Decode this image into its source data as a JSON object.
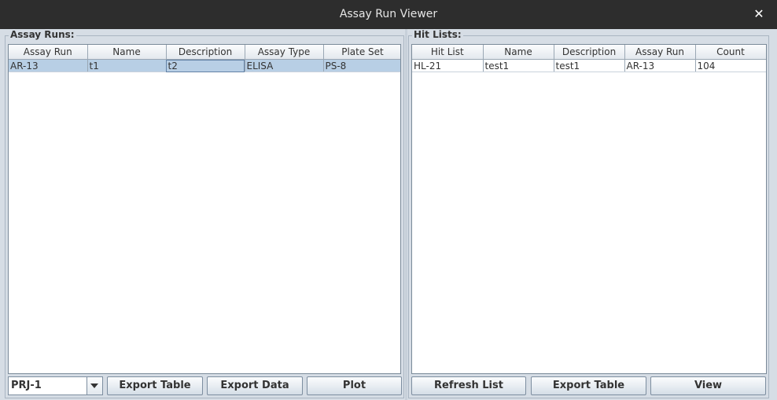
{
  "window": {
    "title": "Assay Run Viewer"
  },
  "assay_runs": {
    "legend": "Assay Runs:",
    "columns": [
      "Assay Run",
      "Name",
      "Description",
      "Assay Type",
      "Plate Set"
    ],
    "rows": [
      [
        "AR-13",
        "t1",
        "t2",
        "ELISA",
        "PS-8"
      ]
    ],
    "project_select": "PRJ-1",
    "buttons": {
      "export_table": "Export Table",
      "export_data": "Export Data",
      "plot": "Plot"
    }
  },
  "hit_lists": {
    "legend": "Hit Lists:",
    "columns": [
      "Hit List",
      "Name",
      "Description",
      "Assay Run",
      "Count"
    ],
    "rows": [
      [
        "HL-21",
        "test1",
        "test1",
        "AR-13",
        "104"
      ]
    ],
    "buttons": {
      "refresh_list": "Refresh List",
      "export_table": "Export Table",
      "view": "View"
    }
  },
  "colors": {
    "selection": "#b8cfe5",
    "title_bar": "#2d2d2d",
    "panel_background": "#d6dde5"
  }
}
